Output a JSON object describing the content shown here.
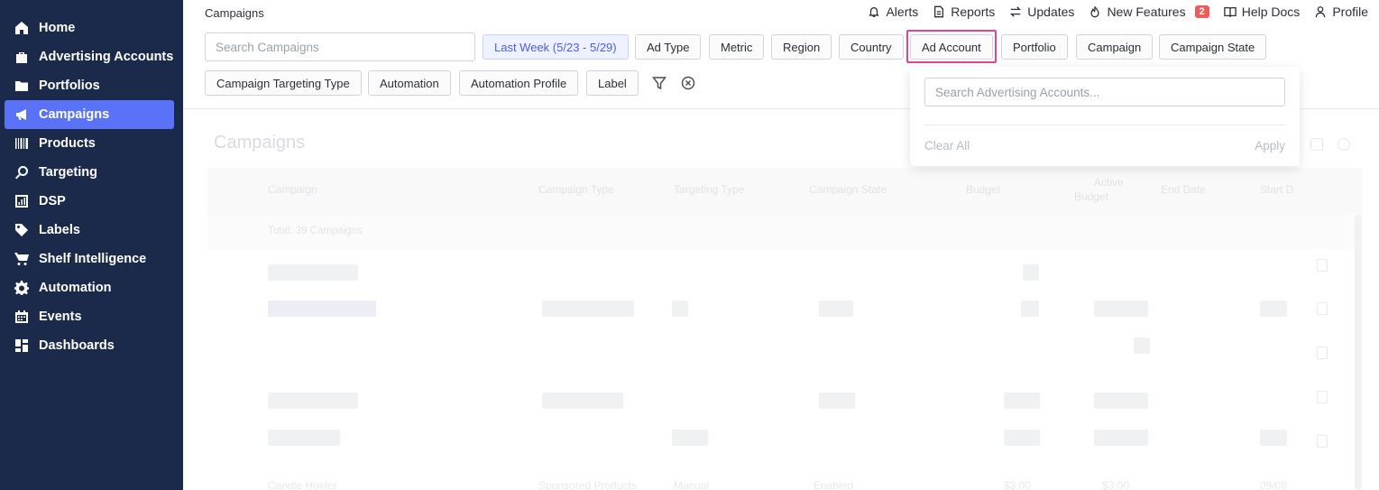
{
  "sidebar": {
    "items": [
      {
        "label": "Home",
        "icon": "home-icon"
      },
      {
        "label": "Advertising Accounts",
        "icon": "briefcase-icon"
      },
      {
        "label": "Portfolios",
        "icon": "folder-icon"
      },
      {
        "label": "Campaigns",
        "icon": "megaphone-icon",
        "active": true
      },
      {
        "label": "Products",
        "icon": "barcode-icon"
      },
      {
        "label": "Targeting",
        "icon": "search-icon"
      },
      {
        "label": "DSP",
        "icon": "chart-box-icon"
      },
      {
        "label": "Labels",
        "icon": "tag-icon"
      },
      {
        "label": "Shelf Intelligence",
        "icon": "cart-icon"
      },
      {
        "label": "Automation",
        "icon": "gear-icon"
      },
      {
        "label": "Events",
        "icon": "calendar-icon"
      },
      {
        "label": "Dashboards",
        "icon": "dashboard-icon"
      }
    ]
  },
  "header": {
    "breadcrumb": "Campaigns",
    "links": {
      "alerts": "Alerts",
      "reports": "Reports",
      "updates": "Updates",
      "new_features": "New Features",
      "new_features_count": "2",
      "help_docs": "Help Docs",
      "profile": "Profile"
    }
  },
  "filters": {
    "search_placeholder": "Search Campaigns",
    "date_range": "Last Week (5/23 - 5/29)",
    "ad_type": "Ad Type",
    "metric": "Metric",
    "region": "Region",
    "country": "Country",
    "ad_account": "Ad Account",
    "portfolio": "Portfolio",
    "campaign": "Campaign",
    "campaign_state": "Campaign State",
    "campaign_targeting_type": "Campaign Targeting Type",
    "automation": "Automation",
    "automation_profile": "Automation Profile",
    "label": "Label"
  },
  "dropdown": {
    "search_placeholder": "Search Advertising Accounts...",
    "clear_all": "Clear All",
    "apply": "Apply"
  },
  "background": {
    "title": "Campaigns",
    "columns": {
      "campaign": "Campaign",
      "campaign_type": "Campaign Type",
      "targeting_type": "Targeting Type",
      "campaign_state": "Campaign State",
      "budget": "Budget",
      "active_budget_1": "Active",
      "active_budget_2": "Budget",
      "end_date": "End Date",
      "start_date": "Start D"
    },
    "total": "Total: 39 Campaigns",
    "last_row": {
      "campaign": "Candle Holder",
      "campaign_type": "Sponsored Products",
      "targeting_type": "Manual",
      "state": "Enabled",
      "budget": "$3.00",
      "active_budget": "$3.00",
      "start": "09/08"
    }
  },
  "colors": {
    "sidebar_bg": "#1b2a4a",
    "active_item": "#5a72f7",
    "highlight": "#e5458d",
    "badge": "#ef5a5a"
  }
}
